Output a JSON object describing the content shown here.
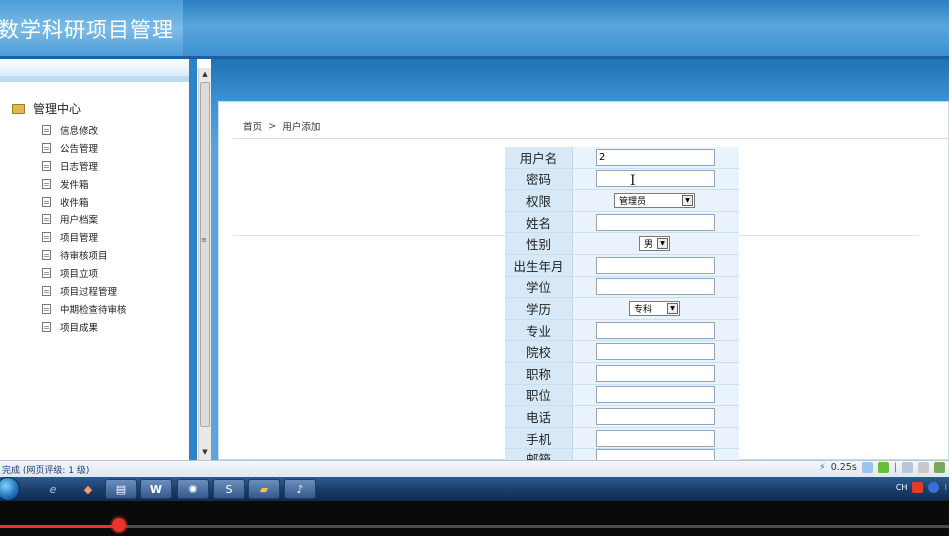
{
  "header": {
    "title": "数学科研项目管理",
    "colors": {
      "banner": "#3a8fd0"
    }
  },
  "sidebar": {
    "root_label": "管理中心",
    "items": [
      {
        "label": "信息修改"
      },
      {
        "label": "公告管理"
      },
      {
        "label": "日志管理"
      },
      {
        "label": "发件箱"
      },
      {
        "label": "收件箱"
      },
      {
        "label": "用户档案"
      },
      {
        "label": "项目管理"
      },
      {
        "label": "待审核项目"
      },
      {
        "label": "项目立项"
      },
      {
        "label": "项目过程管理"
      },
      {
        "label": "中期检查待审核"
      },
      {
        "label": "项目成果"
      }
    ]
  },
  "breadcrumb": {
    "home": "首页",
    "separator": ">",
    "current": "用户添加"
  },
  "form": {
    "username": {
      "label": "用户名",
      "value": "2"
    },
    "password": {
      "label": "密码",
      "value": ""
    },
    "role": {
      "label": "权限",
      "selected": "管理员"
    },
    "name": {
      "label": "姓名",
      "value": ""
    },
    "gender": {
      "label": "性别",
      "selected": "男"
    },
    "birth": {
      "label": "出生年月",
      "value": ""
    },
    "degree": {
      "label": "学位",
      "value": ""
    },
    "education": {
      "label": "学历",
      "selected": "专科"
    },
    "major": {
      "label": "专业",
      "value": ""
    },
    "school": {
      "label": "院校",
      "value": ""
    },
    "title": {
      "label": "职称",
      "value": ""
    },
    "position": {
      "label": "职位",
      "value": ""
    },
    "phone": {
      "label": "电话",
      "value": ""
    },
    "mobile": {
      "label": "手机",
      "value": ""
    },
    "email": {
      "label": "邮箱",
      "value": ""
    }
  },
  "statusbar": {
    "left_text": "完成 (网页评级: 1 级)",
    "speed": "0.25s"
  },
  "taskbar": {
    "tray_lang": "CH",
    "apps": [
      "ie-icon",
      "paint-icon",
      "explorer-icon",
      "word-icon",
      "settings-icon",
      "sogou-icon",
      "folder-app-icon",
      "media-icon"
    ]
  },
  "video": {
    "progress": 0.125,
    "accent": "#e8342a"
  }
}
